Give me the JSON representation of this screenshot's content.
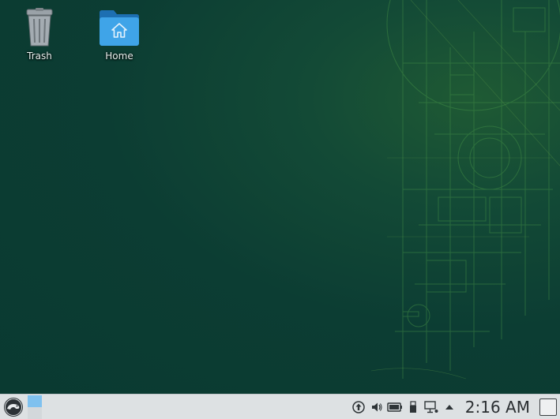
{
  "desktop": {
    "icons": [
      {
        "label": "Trash",
        "icon": "trash-icon"
      },
      {
        "label": "Home",
        "icon": "home-folder-icon"
      }
    ]
  },
  "panel": {
    "launcher_icon": "opensuse-gecko-icon",
    "tray_icons": [
      "updates-icon",
      "volume-icon",
      "battery-icon",
      "usb-device-icon",
      "network-icon",
      "expand-arrow-icon"
    ],
    "clock": "2:16 AM"
  },
  "colors": {
    "desktop_bg": "#0b3b32",
    "panel_bg": "#dde1e3",
    "accent": "#2f8fd6"
  }
}
